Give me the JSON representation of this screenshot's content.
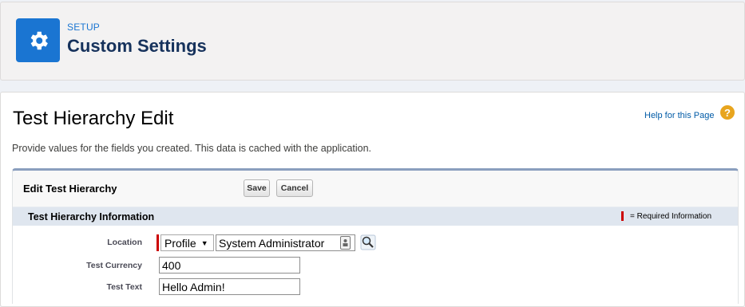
{
  "header": {
    "section_label": "SETUP",
    "title": "Custom Settings",
    "icon": "gear-icon",
    "icon_color": "#1a75d2"
  },
  "page": {
    "title": "Test Hierarchy Edit",
    "help_link": "Help for this Page",
    "help_icon": "question-icon",
    "description": "Provide values for the fields you created. This data is cached with the application."
  },
  "edit_block": {
    "title": "Edit Test Hierarchy",
    "save_label": "Save",
    "cancel_label": "Cancel"
  },
  "section": {
    "title": "Test Hierarchy Information",
    "required_legend": "= Required Information",
    "required_color": "#cc0000"
  },
  "fields": {
    "location": {
      "label": "Location",
      "type_selected": "Profile",
      "value": "System Administrator"
    },
    "currency": {
      "label": "Test Currency",
      "value": "400"
    },
    "text": {
      "label": "Test Text",
      "value": "Hello Admin!"
    }
  }
}
